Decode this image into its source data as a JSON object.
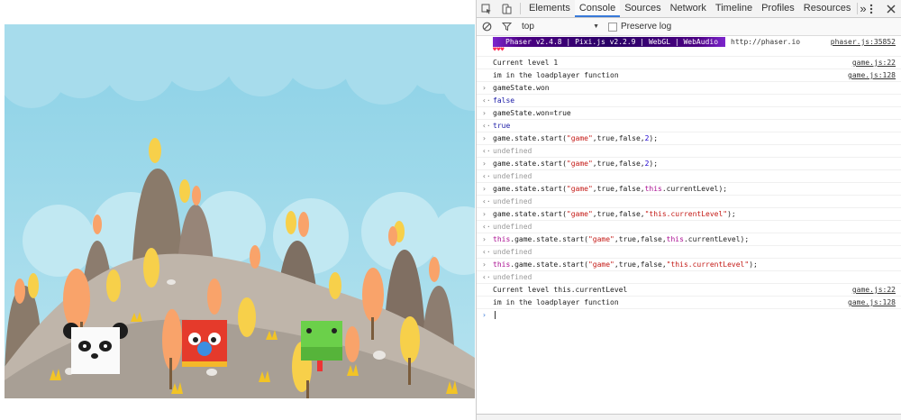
{
  "devtools": {
    "tabs": [
      "Elements",
      "Console",
      "Sources",
      "Network",
      "Timeline",
      "Profiles",
      "Resources"
    ],
    "active_tab": "Console",
    "more_tabs_glyph": "»",
    "filter": {
      "context": "top",
      "context_arrow": "▼",
      "preserve_log": "Preserve log"
    },
    "console": {
      "phaser_banner": " Phaser v2.4.8 | Pixi.js v2.2.9 | WebGL | WebAudio ",
      "phaser_url": "http://phaser.io",
      "phaser_src": "phaser.js:35852",
      "hearts": "♥♥♥",
      "log1": "Current level 1",
      "log1_src": "game.js:22",
      "log2": "im in the loadplayer function",
      "log2_src": "game.js:128",
      "cmd1": "gameState.won",
      "res1": "false",
      "cmd2": "gameState.won=true",
      "res2": "true",
      "undefined": "undefined",
      "log3": "Current level this.currentLevel",
      "log3_src": "game.js:22",
      "log4": "im in the loadplayer function",
      "log4_src": "game.js:128",
      "input_prefix": "›",
      "result_prefix": "‹·",
      "c3": {
        "a": "game.state.start(",
        "s": "\"game\"",
        "b": ",true,false,",
        "n": "2",
        "c": ");"
      },
      "c4": {
        "a": "game.state.start(",
        "s": "\"game\"",
        "b": ",true,false,",
        "n": "2",
        "c": ");"
      },
      "c5": {
        "a": "game.state.start(",
        "s": "\"game\"",
        "b": ",true,false,",
        "k": "this",
        "d": ".currentLevel);"
      },
      "c6": {
        "a": "game.state.start(",
        "s": "\"game\"",
        "b": ",true,false,",
        "s2": "\"this.currentLevel\"",
        "c": ");"
      },
      "c7": {
        "k": "this",
        "a": ".game.state.start(",
        "s": "\"game\"",
        "b": ",true,false,",
        "k2": "this",
        "d": ".currentLevel);"
      },
      "c8": {
        "k": "this",
        "a": ".game.state.start(",
        "s": "\"game\"",
        "b": ",true,false,",
        "s2": "\"this.currentLevel\"",
        "c": ");"
      }
    }
  },
  "colors": {
    "sky": "#8dd3e8",
    "hill": "#a79e94",
    "tab_active": "#3879d9",
    "string": "#c41a16",
    "number": "#1c00cf",
    "keyword": "#aa0d91"
  }
}
